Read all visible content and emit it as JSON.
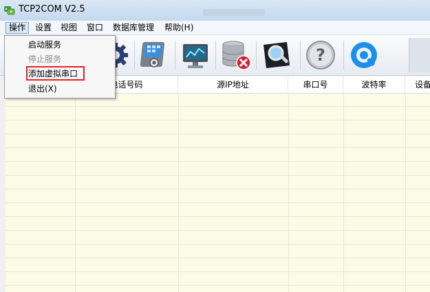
{
  "window": {
    "title": "TCP2COM V2.5"
  },
  "menubar": {
    "items": [
      "操作",
      "设置",
      "视图",
      "窗口",
      "数据库管理",
      "帮助(H)"
    ]
  },
  "dropdown": {
    "items": [
      {
        "label": "启动服务",
        "enabled": true
      },
      {
        "label": "停止服务",
        "enabled": false
      },
      {
        "label": "添加虚拟串口",
        "enabled": true,
        "highlighted": true
      },
      {
        "label": "退出(X)",
        "enabled": true
      }
    ]
  },
  "toolbar": {
    "buttons": [
      {
        "icon": "gear-icon"
      },
      {
        "icon": "tablet-settings-icon"
      },
      {
        "icon": "monitor-icon"
      },
      {
        "icon": "database-delete-icon"
      },
      {
        "icon": "magnifier-icon"
      },
      {
        "icon": "help-icon"
      },
      {
        "icon": "quicktime-icon"
      }
    ]
  },
  "table": {
    "columns": [
      "电话号码",
      "源IP地址",
      "串口号",
      "波特率",
      "设备"
    ]
  },
  "colors": {
    "grid_background": "#fafce6",
    "highlight_border": "#e0242b",
    "menu_open_background": "#dbe8f6"
  }
}
